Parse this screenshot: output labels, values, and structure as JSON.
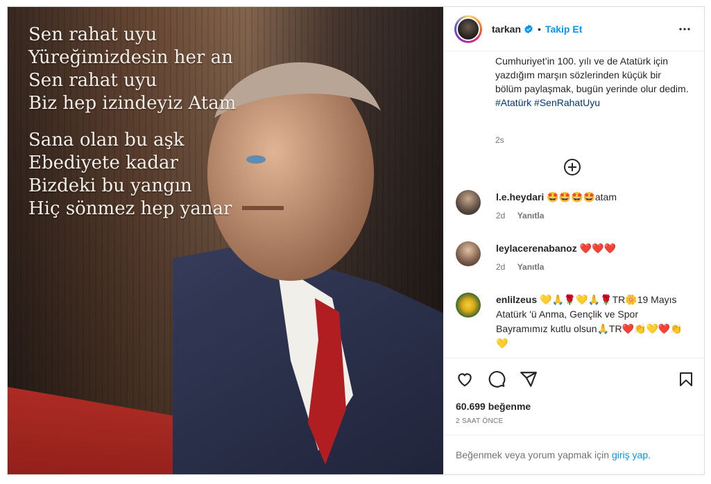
{
  "post": {
    "poem": {
      "stanza1": [
        "Sen rahat uyu",
        "Yüreğimizdesin her an",
        "Sen rahat uyu",
        "Biz hep izindeyiz Atam"
      ],
      "stanza2": [
        "Sana olan bu aşk",
        "Ebediyete kadar",
        "Bizdeki bu yangın",
        "Hiç sönmez hep yanar"
      ]
    }
  },
  "header": {
    "username": "tarkan",
    "separator": "•",
    "follow_label": "Takip Et",
    "more_icon": "more-horizontal-icon",
    "verified_icon": "verified-badge-icon"
  },
  "caption": {
    "text": "Cumhuriyet’in 100. yılı ve de Atatürk için yazdığım marşın sözlerinden küçük bir bölüm paylaşmak, bugün yerinde olur dedim.",
    "tags": "#Atatürk #SenRahatUyu",
    "time": "2s"
  },
  "comments": [
    {
      "user": "l.e.heydari",
      "text": "🤩🤩🤩🤩atam",
      "time": "2d",
      "reply": "Yanıtla"
    },
    {
      "user": "leylacerenabanoz",
      "text": "❤️❤️❤️",
      "time": "2d",
      "reply": "Yanıtla"
    },
    {
      "user": "enlilzeus",
      "text": "💛🙏🌹💛🙏🌹TR🌼19 Mayıs Atatürk 'ü Anma, Gençlik ve Spor Bayramımız kutlu olsun🙏TR❤️👏💛❤️👏💛"
    }
  ],
  "actions": {
    "icons": [
      "heart-icon",
      "comment-icon",
      "share-icon",
      "bookmark-icon"
    ],
    "likes": "60.699 beğenme",
    "time": "2 SAAT ÖNCE"
  },
  "login": {
    "text": "Beğenmek veya yorum yapmak için",
    "link": "giriş yap",
    "suffix": "."
  },
  "colors": {
    "link_blue": "#0095f6",
    "hashtag": "#00376b",
    "muted": "#737373",
    "border": "#dbdbdb"
  }
}
